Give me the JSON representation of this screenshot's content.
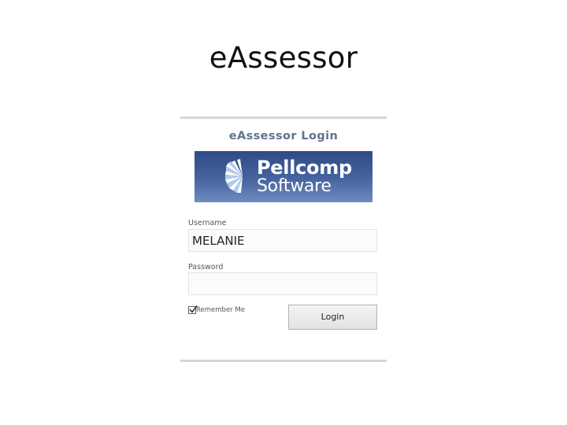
{
  "slide": {
    "title": "eAssessor"
  },
  "login_form": {
    "heading": "eAssessor Login",
    "logo": {
      "line1": "Pellcomp",
      "line2": "Software",
      "icon": "pellcomp-logo-icon"
    },
    "username": {
      "label": "Username",
      "value": "MELANIE"
    },
    "password": {
      "label": "Password",
      "value": ""
    },
    "remember_me": {
      "label": "Remember Me",
      "checked": true
    },
    "login_button_label": "Login"
  },
  "colors": {
    "heading_text": "#5e7490",
    "banner_top": "#2f4a87",
    "banner_bottom": "#6f8cc0",
    "panel_rule": "#d6d6d6"
  }
}
